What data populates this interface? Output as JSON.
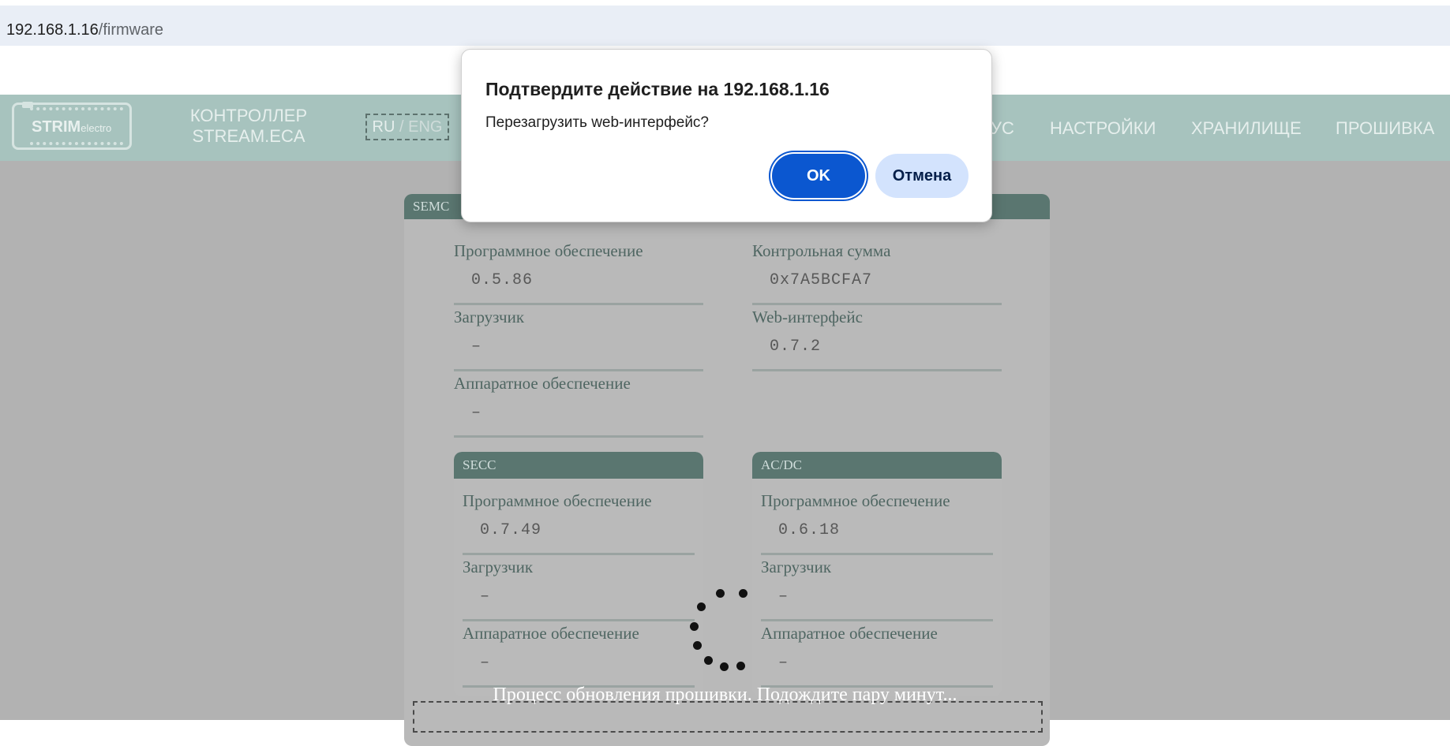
{
  "browser": {
    "address_host": "192.168.1.16",
    "address_path": "/firmware"
  },
  "header": {
    "logo_main": "STRIM",
    "logo_sub": "electro",
    "device_name_line1": "КОНТРОЛЛЕР",
    "device_name_line2": "STREAM.ECA",
    "lang_ru": "RU",
    "lang_sep": " / ",
    "lang_eng": "ENG",
    "nav": [
      "УС",
      "НАСТРОЙКИ",
      "ХРАНИЛИЩЕ",
      "ПРОШИВКА"
    ]
  },
  "semc": {
    "title": "SEMC",
    "software_label": "Программное обеспечение",
    "software_value": "0.5.86",
    "checksum_label": "Контрольная сумма",
    "checksum_value": "0x7A5BCFA7",
    "bootloader_label": "Загрузчик",
    "bootloader_value": "–",
    "web_label": "Web-интерфейс",
    "web_value": "0.7.2",
    "hardware_label": "Аппаратное обеспечение",
    "hardware_value": "–"
  },
  "secc": {
    "title": "SECC",
    "software_label": "Программное обеспечение",
    "software_value": "0.7.49",
    "bootloader_label": "Загрузчик",
    "bootloader_value": "–",
    "hardware_label": "Аппаратное обеспечение",
    "hardware_value": "–"
  },
  "acdc": {
    "title": "AC/DC",
    "software_label": "Программное обеспечение",
    "software_value": "0.6.18",
    "bootloader_label": "Загрузчик",
    "bootloader_value": "–",
    "hardware_label": "Аппаратное обеспечение",
    "hardware_value": "–"
  },
  "progress_message": "Процесс обновления прошивки. Подождите пару минут...",
  "dialog": {
    "title": "Подтвердите действие на 192.168.1.16",
    "message": "Перезагрузить web-интерфейс?",
    "ok_label": "OK",
    "cancel_label": "Отмена"
  },
  "colors": {
    "header_bg": "#a7c3be",
    "card_head_bg": "#5a7670",
    "dialog_ok_bg": "#0b57d0",
    "dialog_cancel_bg": "#d3e3fd"
  }
}
